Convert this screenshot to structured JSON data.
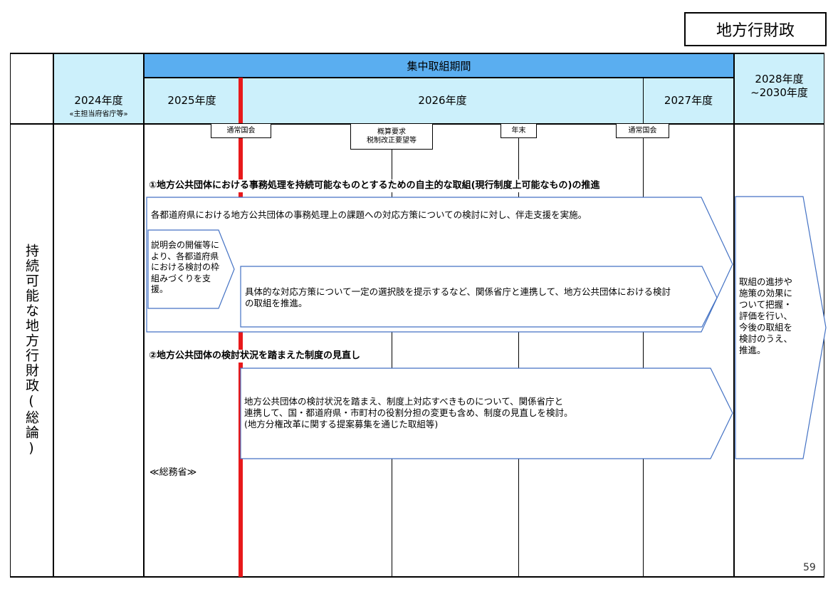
{
  "page_tag": "地方行財政",
  "page_number": "59",
  "header": {
    "intensive_period": "集中取組期間",
    "fy2024": "2024年度",
    "fy2024_sub": "«主担当府省庁等»",
    "fy2025": "2025年度",
    "fy2026": "2026年度",
    "fy2027": "2027年度",
    "fy2028_line1": "2028年度",
    "fy2028_line2": "~2030年度"
  },
  "row_title": "持続可能な地方行財政(総論)",
  "milestones": {
    "diet1": "通常国会",
    "budget_line1": "概算要求",
    "budget_line2": "税制改正要望等",
    "year_end": "年末",
    "diet2": "通常国会"
  },
  "section1": {
    "title": "①地方公共団体における事務処理を持続可能なものとするための自主的な取組(現行制度上可能なもの)の推進",
    "arrow_main": "各都道府県における地方公共団体の事務処理上の課題への対応方策についての検討に対し、伴走支援を実施。",
    "arrow_small": "説明会の開催等により、各都道府県における検討の枠組みづくりを支援。",
    "arrow_inner": "具体的な対応方策について一定の選択肢を提示するなど、関係省庁と連携して、地方公共団体における検討の取組を推進。"
  },
  "section2": {
    "title": "②地方公共団体の検討状況を踏まえた制度の見直し",
    "arrow_line1": "地方公共団体の検討状況を踏まえ、制度上対応すべきものについて、関係省庁と",
    "arrow_line2": "連携して、国・都道府県・市町村の役割分担の変更も含め、制度の見直しを検討。",
    "arrow_line3": "(地方分権改革に関する提案募集を通じた取組等)"
  },
  "ministry": "≪総務省≫",
  "future_arrow": "取組の進捗や施策の効果について把握・評価を行い、今後の取組を検討のうえ、推進。"
}
